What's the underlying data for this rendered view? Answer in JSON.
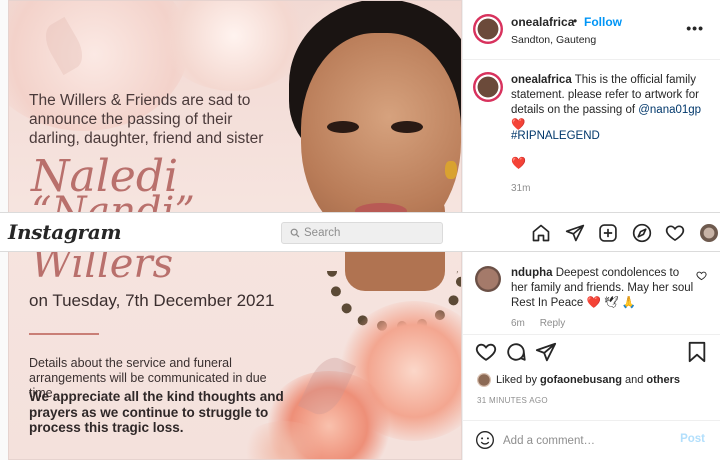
{
  "artwork": {
    "announcement": "The Willers & Friends are sad to announce the passing of their darling, daughter, friend and sister",
    "name_first": "Naledi",
    "name_nick": "“Nandi”",
    "name_last": "Willers",
    "date": "on Tuesday, 7th December 2021",
    "details": "Details about the service and funeral arrangements will be communicated in due time.",
    "appreciation": "We appreciate all the kind thoughts and prayers as we continue to struggle to process this tragic loss."
  },
  "post_header": {
    "username": "onealafrica",
    "separator": "•",
    "follow_label": "Follow",
    "location": "Sandton, Gauteng",
    "more_label": "•••"
  },
  "caption": {
    "username": "onealafrica",
    "text": "This is the official family statement. please refer to artwork for details on the passing of",
    "mention": "@nana01gp",
    "heart": "❤️",
    "hashtag": "#RIPNALEGEND",
    "heart_line": "❤️",
    "time": "31m"
  },
  "comment": {
    "username": "ndupha",
    "text": "Deepest condolences to her family and friends. May her soul Rest In Peace",
    "emojis": "❤️ 🕊 🙏",
    "time": "6m",
    "reply_label": "Reply"
  },
  "likes": {
    "prefix": "Liked by",
    "user": "gofaonebusang",
    "conjunction": "and",
    "others": "others"
  },
  "posted_ago": "31 MINUTES AGO",
  "add_comment": {
    "placeholder": "Add a comment…",
    "post_label": "Post"
  },
  "nav": {
    "logo": "Instagram",
    "search_placeholder": "Search"
  },
  "icons": [
    "home-icon",
    "direct-icon",
    "new-post-icon",
    "explore-icon",
    "activity-heart-icon",
    "profile-avatar",
    "search-icon",
    "like-icon",
    "comment-icon",
    "share-icon",
    "save-icon",
    "emoji-icon",
    "more-icon"
  ],
  "colors": {
    "accent_blue": "#0095f6",
    "link_blue": "#00376b",
    "heart_red": "#ed4956",
    "script_rose": "#b9706c"
  }
}
